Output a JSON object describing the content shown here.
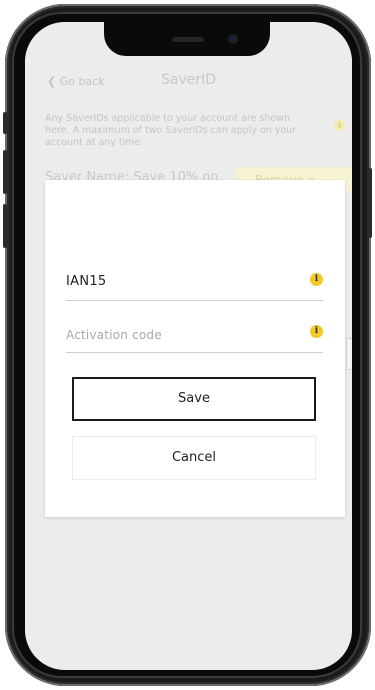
{
  "app": {
    "back_label": "Go back",
    "title": "SaverID",
    "info_text": "Any SaverIDs applicable to your account are shown here. A maximum of two SaverIDs can apply on your account at any time",
    "saver_name": "Saver Name: Save 10% on",
    "remove_label": "Remove »"
  },
  "dialog": {
    "saver_id_value": "IAN15",
    "activation_placeholder": "Activation code",
    "save_label": "Save",
    "cancel_label": "Cancel"
  },
  "icons": {
    "back": "chevron-left-icon",
    "info": "info-icon"
  },
  "colors": {
    "accent_yellow": "#f2c928",
    "frame": "#0a0a0a",
    "overlay": "#ececec"
  }
}
